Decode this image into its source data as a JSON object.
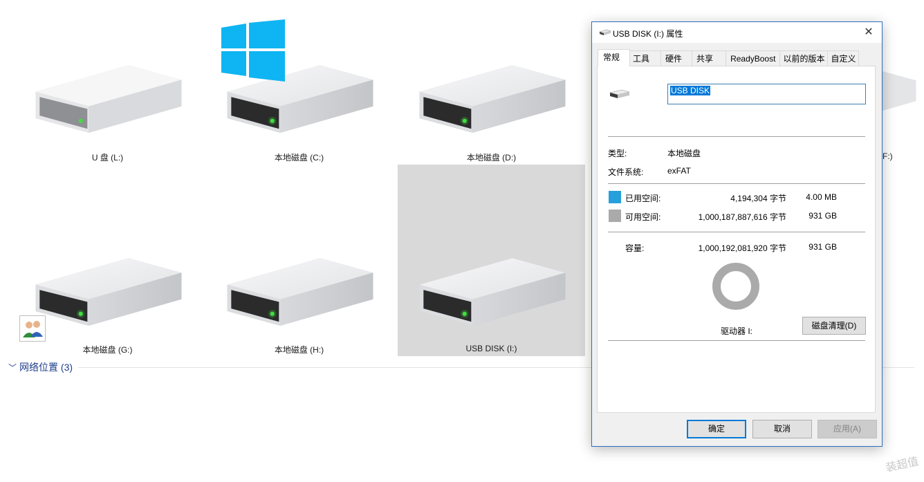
{
  "drives": [
    {
      "label": "U 盘 (L:)"
    },
    {
      "label": "本地磁盘 (C:)"
    },
    {
      "label": "本地磁盘 (D:)"
    },
    {
      "label": "(F:)"
    },
    {
      "label": "本地磁盘 (G:)"
    },
    {
      "label": "本地磁盘 (H:)"
    },
    {
      "label": "USB DISK (I:)"
    }
  ],
  "network_section": {
    "label": "网络位置 (3)"
  },
  "watermark": "装超值",
  "dialog": {
    "title": "USB DISK (I:) 属性",
    "close_glyph": "✕",
    "tabs": [
      "常规",
      "工具",
      "硬件",
      "共享",
      "ReadyBoost",
      "以前的版本",
      "自定义"
    ],
    "active_tab": "常规",
    "name_value": "USB DISK",
    "type_label": "类型:",
    "type_value": "本地磁盘",
    "fs_label": "文件系统:",
    "fs_value": "exFAT",
    "used": {
      "label": "已用空间:",
      "bytes": "4,194,304 字节",
      "size": "4.00 MB",
      "color": "#26a0da"
    },
    "free": {
      "label": "可用空间:",
      "bytes": "1,000,187,887,616 字节",
      "size": "931 GB",
      "color": "#aaaaaa"
    },
    "capacity": {
      "label": "容量:",
      "bytes": "1,000,192,081,920 字节",
      "size": "931 GB"
    },
    "used_fraction": 4.2e-06,
    "drive_label": "驱动器 I:",
    "cleanup_button": "磁盘清理(D)",
    "ok_button": "确定",
    "cancel_button": "取消",
    "apply_button": "应用(A)"
  }
}
